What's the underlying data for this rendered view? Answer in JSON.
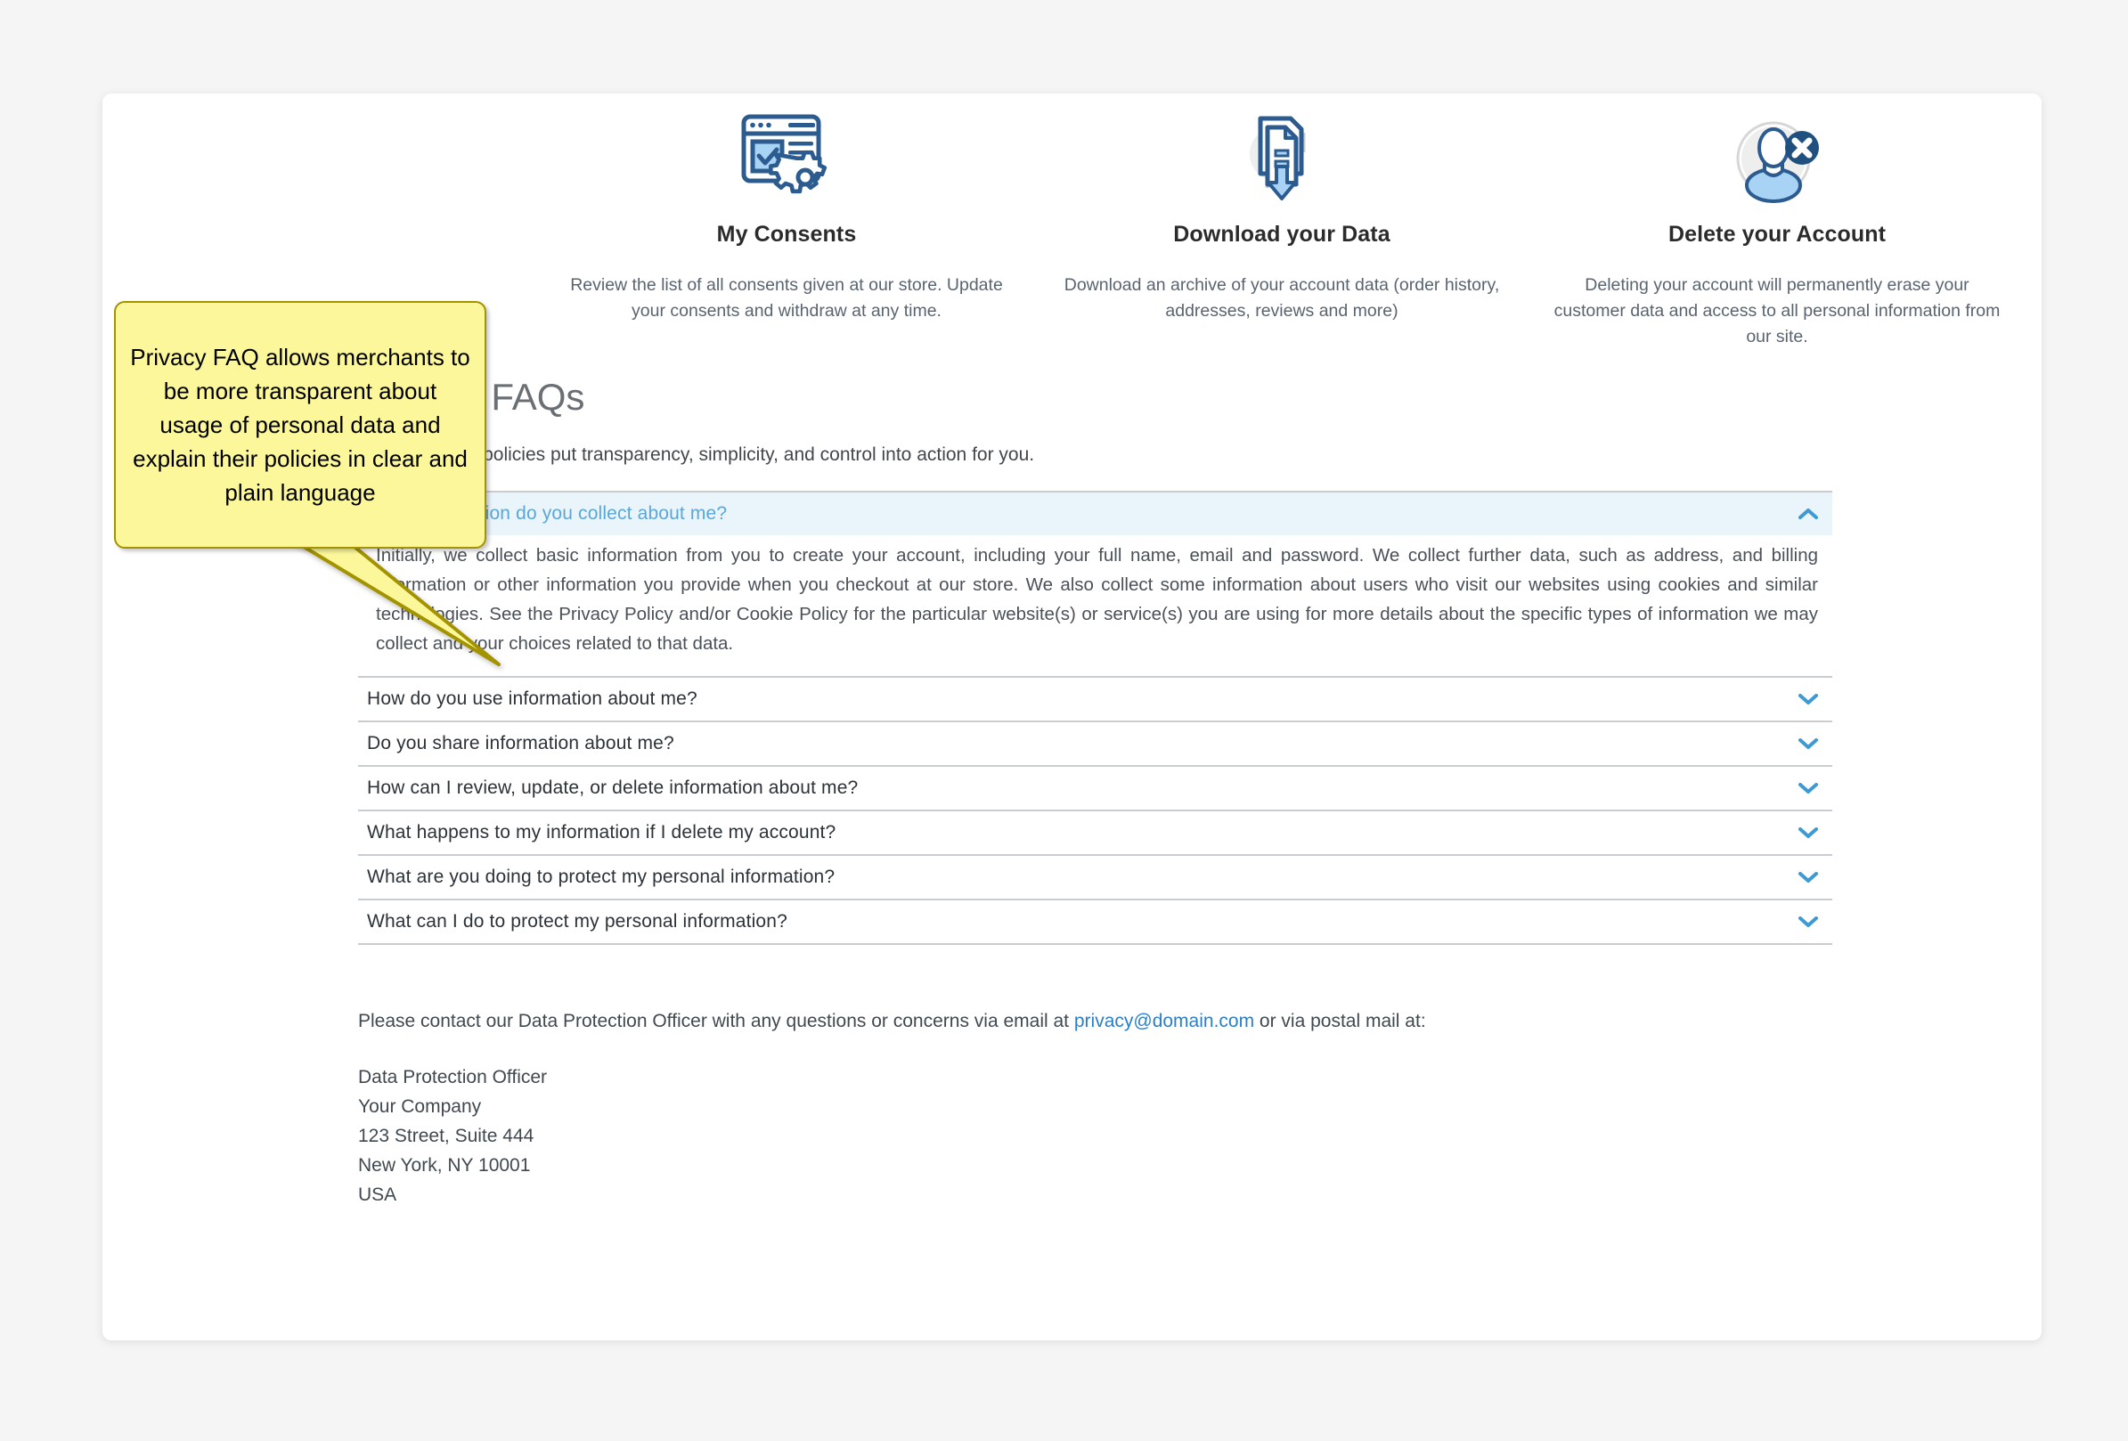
{
  "page": {
    "background_color": "#f5f5f5",
    "card_background": "#ffffff"
  },
  "features": [
    {
      "icon": "browser-checkbox-gear-icon",
      "title": "My Consents",
      "description": "Review the list of all consents given at our store. Update your consents and withdraw at any time."
    },
    {
      "icon": "documents-download-arrow-icon",
      "title": "Download your Data",
      "description": "Download an archive of your account data (order history, addresses, reviews and more)"
    },
    {
      "icon": "user-delete-icon",
      "title": "Delete your Account",
      "description": "Deleting your account will permanently erase your customer data and access to all personal information from our site."
    }
  ],
  "faq": {
    "heading": "Privacy FAQs",
    "subheading": "Learn how our policies put transparency, simplicity, and control into action for you.",
    "items": [
      {
        "question": "What information do you collect about me?",
        "expanded": true,
        "chevron": "chevron-up-icon",
        "answer": "Initially, we collect basic information from you to create your account, including your full name, email and password. We collect further data, such as address, and billing information or other information you provide when you checkout at our store. We also collect some information about users who visit our websites using cookies and similar technologies. See the Privacy Policy and/or Cookie Policy for the particular website(s) or service(s) you are using for more details about the specific types of information we may collect and your choices related to that data."
      },
      {
        "question": "How do you use information about me?",
        "expanded": false,
        "chevron": "chevron-down-icon",
        "answer": ""
      },
      {
        "question": "Do you share information about me?",
        "expanded": false,
        "chevron": "chevron-down-icon",
        "answer": ""
      },
      {
        "question": "How can I review, update, or delete information about me?",
        "expanded": false,
        "chevron": "chevron-down-icon",
        "answer": ""
      },
      {
        "question": "What happens to my information if I delete my account?",
        "expanded": false,
        "chevron": "chevron-down-icon",
        "answer": ""
      },
      {
        "question": "What are you doing to protect my personal information?",
        "expanded": false,
        "chevron": "chevron-down-icon",
        "answer": ""
      },
      {
        "question": "What can I do to protect my personal information?",
        "expanded": false,
        "chevron": "chevron-down-icon",
        "answer": ""
      }
    ]
  },
  "contact": {
    "lead_text": "Please contact our Data Protection Officer with any questions or concerns via email at ",
    "email": "privacy@domain.com",
    "trail_text": " or via postal mail at:",
    "address": "Data Protection Officer\nYour Company\n123 Street, Suite 444\nNew York, NY 10001\nUSA"
  },
  "callout": {
    "text": "Privacy FAQ allows merchants to be more transparent about usage of personal data and explain their policies in clear and plain language",
    "fill_color": "#fbf79a",
    "border_color": "#a39300"
  },
  "colors": {
    "accent_blue": "#2a7fc9",
    "chevron_blue": "#3f9ad4",
    "active_header_bg": "#eaf4fb",
    "divider": "#c9cdd1"
  }
}
